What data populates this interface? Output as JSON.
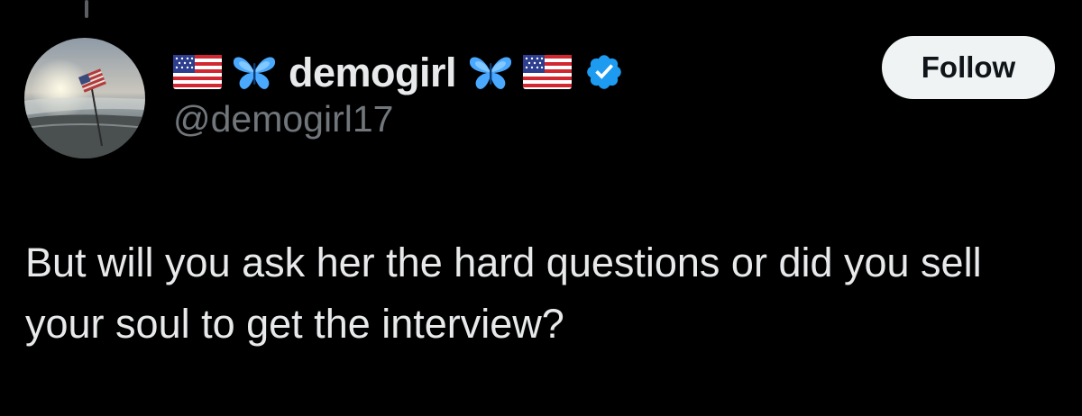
{
  "colors": {
    "background": "#000000",
    "text_primary": "#e7e9ea",
    "text_secondary": "#71767b",
    "verified_badge": "#1d9bf0",
    "follow_button_bg": "#eff3f4",
    "follow_button_text": "#0f1419",
    "butterfly": "#4aa8ff"
  },
  "author": {
    "display_name": "demogirl",
    "handle": "@demogirl17",
    "verified": true,
    "avatar_icon": "beach-sunset-flag-avatar",
    "name_decorations": [
      "us-flag-icon",
      "butterfly-icon",
      "butterfly-icon",
      "us-flag-icon"
    ]
  },
  "follow_button": {
    "label": "Follow"
  },
  "tweet": {
    "text": "But will you ask her the hard questions or did you sell your soul to get the interview?"
  }
}
